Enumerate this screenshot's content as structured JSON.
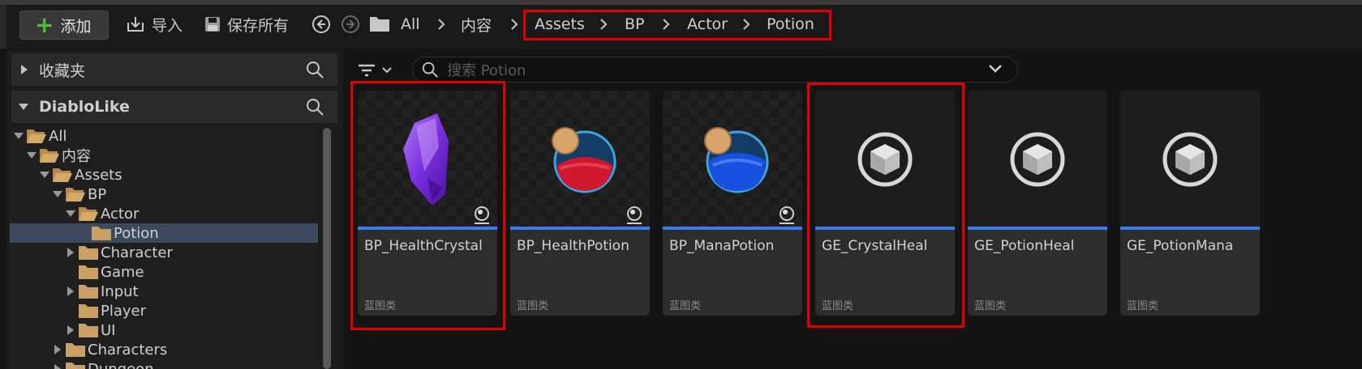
{
  "toolbar": {
    "add_label": "添加",
    "import_label": "导入",
    "save_all_label": "保存所有"
  },
  "breadcrumb": [
    "All",
    "内容",
    "Assets",
    "BP",
    "Actor",
    "Potion"
  ],
  "left_panel": {
    "favorites_label": "收藏夹",
    "project_label": "DiabloLike",
    "tree": [
      {
        "label": "All",
        "depth": 0,
        "expanded": true
      },
      {
        "label": "内容",
        "depth": 1,
        "expanded": true
      },
      {
        "label": "Assets",
        "depth": 2,
        "expanded": true
      },
      {
        "label": "BP",
        "depth": 3,
        "expanded": true
      },
      {
        "label": "Actor",
        "depth": 4,
        "expanded": true
      },
      {
        "label": "Potion",
        "depth": 5,
        "selected": true
      },
      {
        "label": "Character",
        "depth": 4,
        "collapsed": true
      },
      {
        "label": "Game",
        "depth": 4
      },
      {
        "label": "Input",
        "depth": 4,
        "collapsed": true
      },
      {
        "label": "Player",
        "depth": 4
      },
      {
        "label": "UI",
        "depth": 4,
        "collapsed": true
      },
      {
        "label": "Characters",
        "depth": 3,
        "collapsed": true
      },
      {
        "label": "Dungeon",
        "depth": 3,
        "collapsed": true
      }
    ]
  },
  "search": {
    "placeholder": "搜索 Potion"
  },
  "assets": [
    {
      "name": "BP_HealthCrystal",
      "type": "蓝图类",
      "icon": "crystal-icon"
    },
    {
      "name": "BP_HealthPotion",
      "type": "蓝图类",
      "icon": "red-potion-icon"
    },
    {
      "name": "BP_ManaPotion",
      "type": "蓝图类",
      "icon": "blue-potion-icon"
    },
    {
      "name": "GE_CrystalHeal",
      "type": "蓝图类",
      "icon": "cube-icon"
    },
    {
      "name": "GE_PotionHeal",
      "type": "蓝图类",
      "icon": "cube-icon"
    },
    {
      "name": "GE_PotionMana",
      "type": "蓝图类",
      "icon": "cube-icon"
    }
  ],
  "colors": {
    "accent_blue": "#3c7ee8",
    "highlight_red": "#e00000",
    "folder": "#c9a063",
    "add_green": "#4fbf3a"
  }
}
